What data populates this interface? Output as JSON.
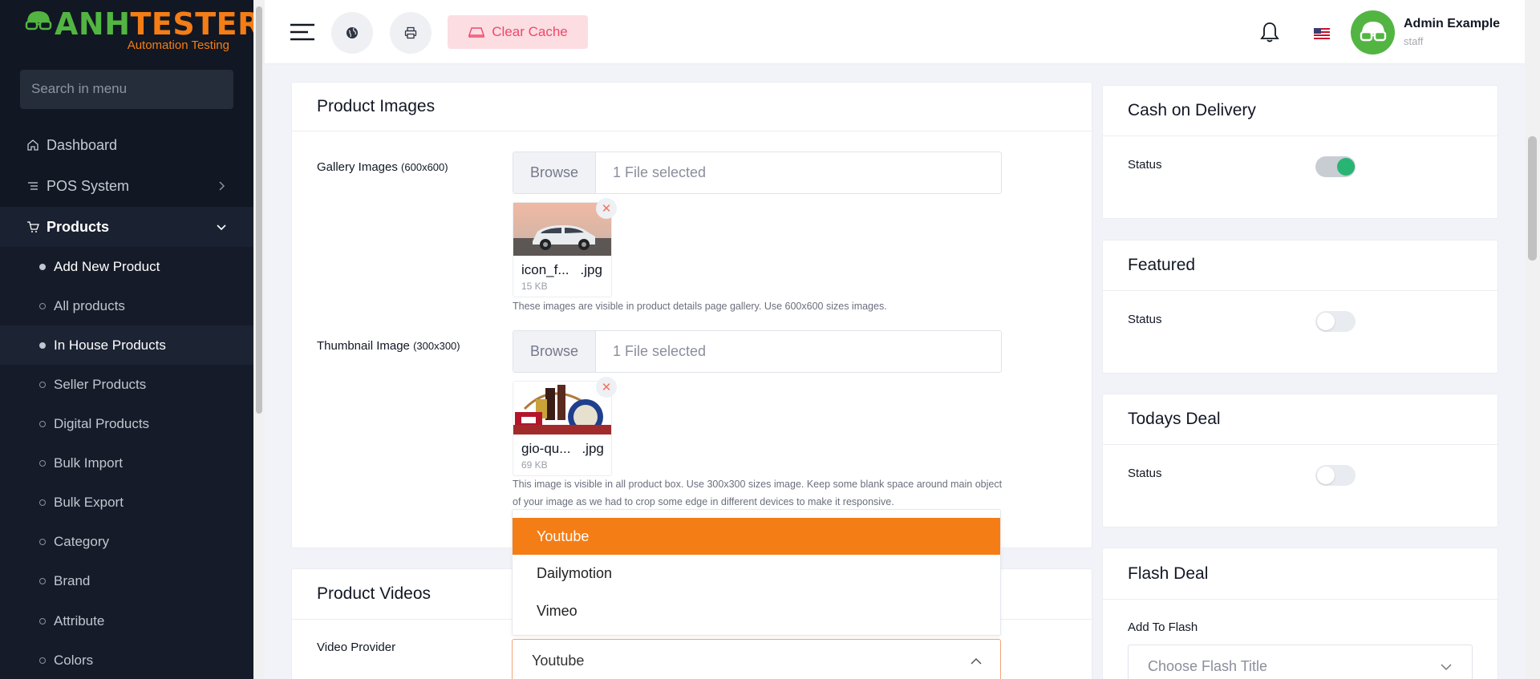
{
  "brand": {
    "logo_part1": "ANH",
    "logo_part2": "TESTER",
    "tagline": "Automation Testing"
  },
  "sidebar": {
    "search_placeholder": "Search in menu",
    "items": [
      {
        "label": "Dashboard",
        "icon": "home-icon"
      },
      {
        "label": "POS System",
        "icon": "list-icon"
      },
      {
        "label": "Products",
        "icon": "cart-icon"
      }
    ],
    "products_submenu": [
      {
        "label": "Add New Product",
        "state": "active"
      },
      {
        "label": "All products",
        "state": "normal"
      },
      {
        "label": "In House Products",
        "state": "highlight"
      },
      {
        "label": "Seller Products",
        "state": "normal"
      },
      {
        "label": "Digital Products",
        "state": "normal"
      },
      {
        "label": "Bulk Import",
        "state": "normal"
      },
      {
        "label": "Bulk Export",
        "state": "normal"
      },
      {
        "label": "Category",
        "state": "normal"
      },
      {
        "label": "Brand",
        "state": "normal"
      },
      {
        "label": "Attribute",
        "state": "normal"
      },
      {
        "label": "Colors",
        "state": "normal"
      }
    ]
  },
  "topbar": {
    "clear_cache_label": "Clear Cache",
    "user_name": "Admin Example",
    "user_role": "staff"
  },
  "product_images": {
    "title": "Product Images",
    "gallery": {
      "label": "Gallery Images",
      "size_hint": "(600x600)",
      "browse_label": "Browse",
      "selected_text": "1 File selected",
      "file_name_start": "icon_f...",
      "file_ext": ".jpg",
      "file_size": "15 KB",
      "help": "These images are visible in product details page gallery. Use 600x600 sizes images."
    },
    "thumbnail": {
      "label": "Thumbnail Image",
      "size_hint": "(300x300)",
      "browse_label": "Browse",
      "selected_text": "1 File selected",
      "file_name_start": "gio-qu...",
      "file_ext": ".jpg",
      "file_size": "69 KB",
      "help": "This image is visible in all product box. Use 300x300 sizes image. Keep some blank space around main object of your image as we had to crop some edge in different devices to make it responsive."
    }
  },
  "product_videos": {
    "title": "Product Videos",
    "provider_label": "Video Provider",
    "provider_value": "Youtube",
    "options": [
      "Youtube",
      "Dailymotion",
      "Vimeo"
    ],
    "selected_index": 0
  },
  "right_panels": {
    "cod": {
      "title": "Cash on Delivery",
      "status_label": "Status",
      "on": true
    },
    "featured": {
      "title": "Featured",
      "status_label": "Status",
      "on": false
    },
    "todays_deal": {
      "title": "Todays Deal",
      "status_label": "Status",
      "on": false
    },
    "flash_deal": {
      "title": "Flash Deal",
      "add_label": "Add To Flash",
      "placeholder": "Choose Flash Title"
    }
  },
  "colors": {
    "accent": "#f47d16",
    "brand_green": "#52b542",
    "toggle_on": "#28b574",
    "danger": "#ef486a"
  }
}
